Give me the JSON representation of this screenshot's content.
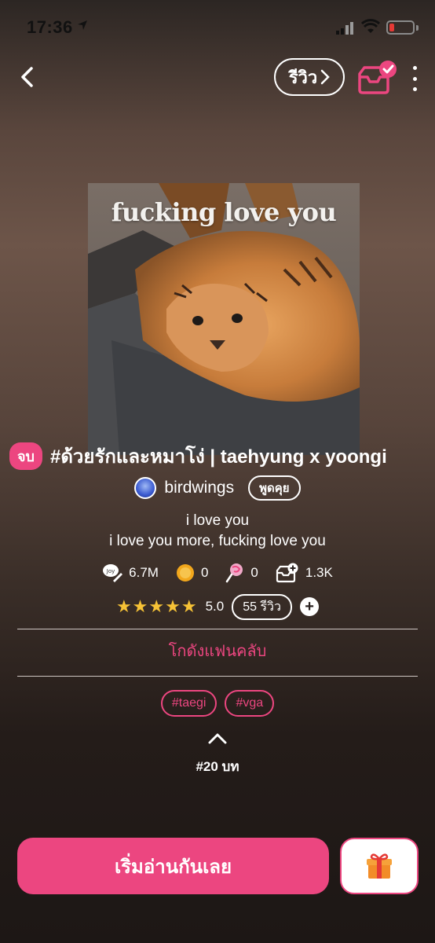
{
  "status_bar": {
    "time": "17:36"
  },
  "header": {
    "review_label": "รีวิว"
  },
  "cover": {
    "overlay_text": "fucking love you"
  },
  "story": {
    "end_badge": "จบ",
    "title": "#ด้วยรักและหมาโง่ | taehyung x yoongi",
    "author": "birdwings",
    "chat_label": "พูดคุย",
    "description_line1": "i love you",
    "description_line2": "i love you more, fucking love you"
  },
  "stats": {
    "views": "6.7M",
    "coins": "0",
    "lollipops": "0",
    "library_adds": "1.3K"
  },
  "rating": {
    "stars": "★★★★★",
    "score": "5.0",
    "reviews_label": "55 รีวิว",
    "add_symbol": "+"
  },
  "fanclub": {
    "label": "โกดังแฟนคลับ"
  },
  "tags": [
    "#taegi",
    "#vga"
  ],
  "chapters": {
    "label": "#20 บท"
  },
  "footer": {
    "read_button": "เริ่มอ่านกันเลย"
  },
  "colors": {
    "accent": "#ec4680",
    "star": "#f6c236"
  }
}
